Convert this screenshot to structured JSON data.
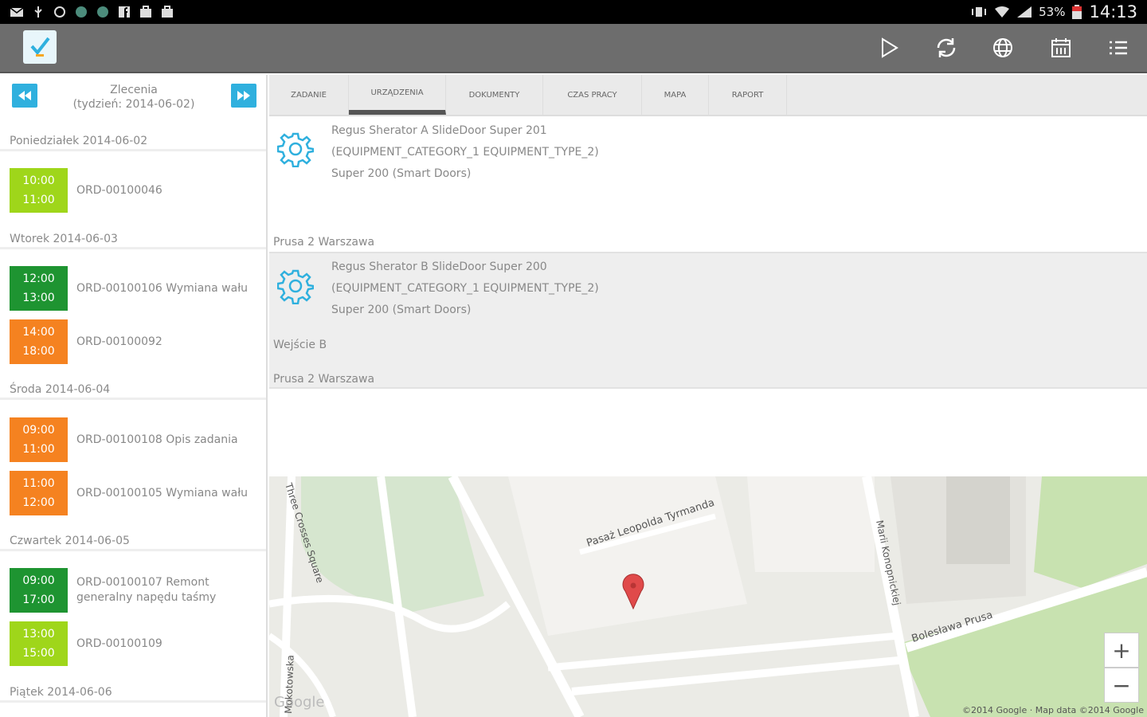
{
  "status_bar": {
    "left_icons": [
      "mail-icon",
      "usb-icon",
      "sync-icon",
      "app-icon",
      "app-icon",
      "facebook-icon",
      "briefcase-icon",
      "briefcase-icon"
    ],
    "battery_percent": "53%",
    "time": "14:13"
  },
  "action_bar": {
    "icons": [
      "play-icon",
      "refresh-icon",
      "globe-icon",
      "calendar-icon",
      "list-icon"
    ]
  },
  "left_panel": {
    "title": "Zlecenia",
    "subtitle": "(tydzień: 2014-06-02)",
    "days": [
      {
        "label": "Poniedziałek 2014-06-02",
        "orders": [
          {
            "start": "10:00",
            "end": "11:00",
            "text": "ORD-00100046",
            "color": "#9fd61a"
          }
        ]
      },
      {
        "label": "Wtorek 2014-06-03",
        "orders": [
          {
            "start": "12:00",
            "end": "13:00",
            "text": "ORD-00100106 Wymiana wału",
            "color": "#1e9431"
          },
          {
            "start": "14:00",
            "end": "18:00",
            "text": "ORD-00100092",
            "color": "#f58220"
          }
        ]
      },
      {
        "label": "Środa 2014-06-04",
        "orders": [
          {
            "start": "09:00",
            "end": "11:00",
            "text": "ORD-00100108 Opis zadania",
            "color": "#f58220"
          },
          {
            "start": "11:00",
            "end": "12:00",
            "text": "ORD-00100105 Wymiana wału",
            "color": "#f58220"
          }
        ]
      },
      {
        "label": "Czwartek 2014-06-05",
        "orders": [
          {
            "start": "09:00",
            "end": "17:00",
            "text": "ORD-00100107 Remont generalny napędu taśmy",
            "color": "#1e9431"
          },
          {
            "start": "13:00",
            "end": "15:00",
            "text": "ORD-00100109",
            "color": "#9fd61a"
          }
        ]
      },
      {
        "label": "Piątek 2014-06-06",
        "orders": []
      }
    ]
  },
  "tabs": [
    {
      "label": "ZADANIE",
      "active": false
    },
    {
      "label": "URZĄDZENIA",
      "active": true
    },
    {
      "label": "DOKUMENTY",
      "active": false
    },
    {
      "label": "CZAS PRACY",
      "active": false
    },
    {
      "label": "MAPA",
      "active": false
    },
    {
      "label": "RAPORT",
      "active": false
    }
  ],
  "equipment": [
    {
      "name": "Regus Sherator A SlideDoor Super 201",
      "category": "(EQUIPMENT_CATEGORY_1 EQUIPMENT_TYPE_2)",
      "model": "Super 200 (Smart Doors)",
      "location": "",
      "address": "Prusa 2 Warszawa"
    },
    {
      "name": "Regus Sherator B SlideDoor Super 200",
      "category": "(EQUIPMENT_CATEGORY_1 EQUIPMENT_TYPE_2)",
      "model": "Super 200 (Smart Doors)",
      "location": "Wejście B",
      "address": "Prusa 2 Warszawa"
    }
  ],
  "map": {
    "streets": [
      "Pasaż Leopolda Tyrmanda",
      "Three Crosses Square",
      "Marii Konopnickiej",
      "Bolesława Prusa",
      "Mokotowska"
    ],
    "zoom_in": "+",
    "zoom_out": "−",
    "logo": "Google",
    "attribution": "©2014 Google · Map data ©2014 Google",
    "pin_color": "#e04a4a"
  }
}
